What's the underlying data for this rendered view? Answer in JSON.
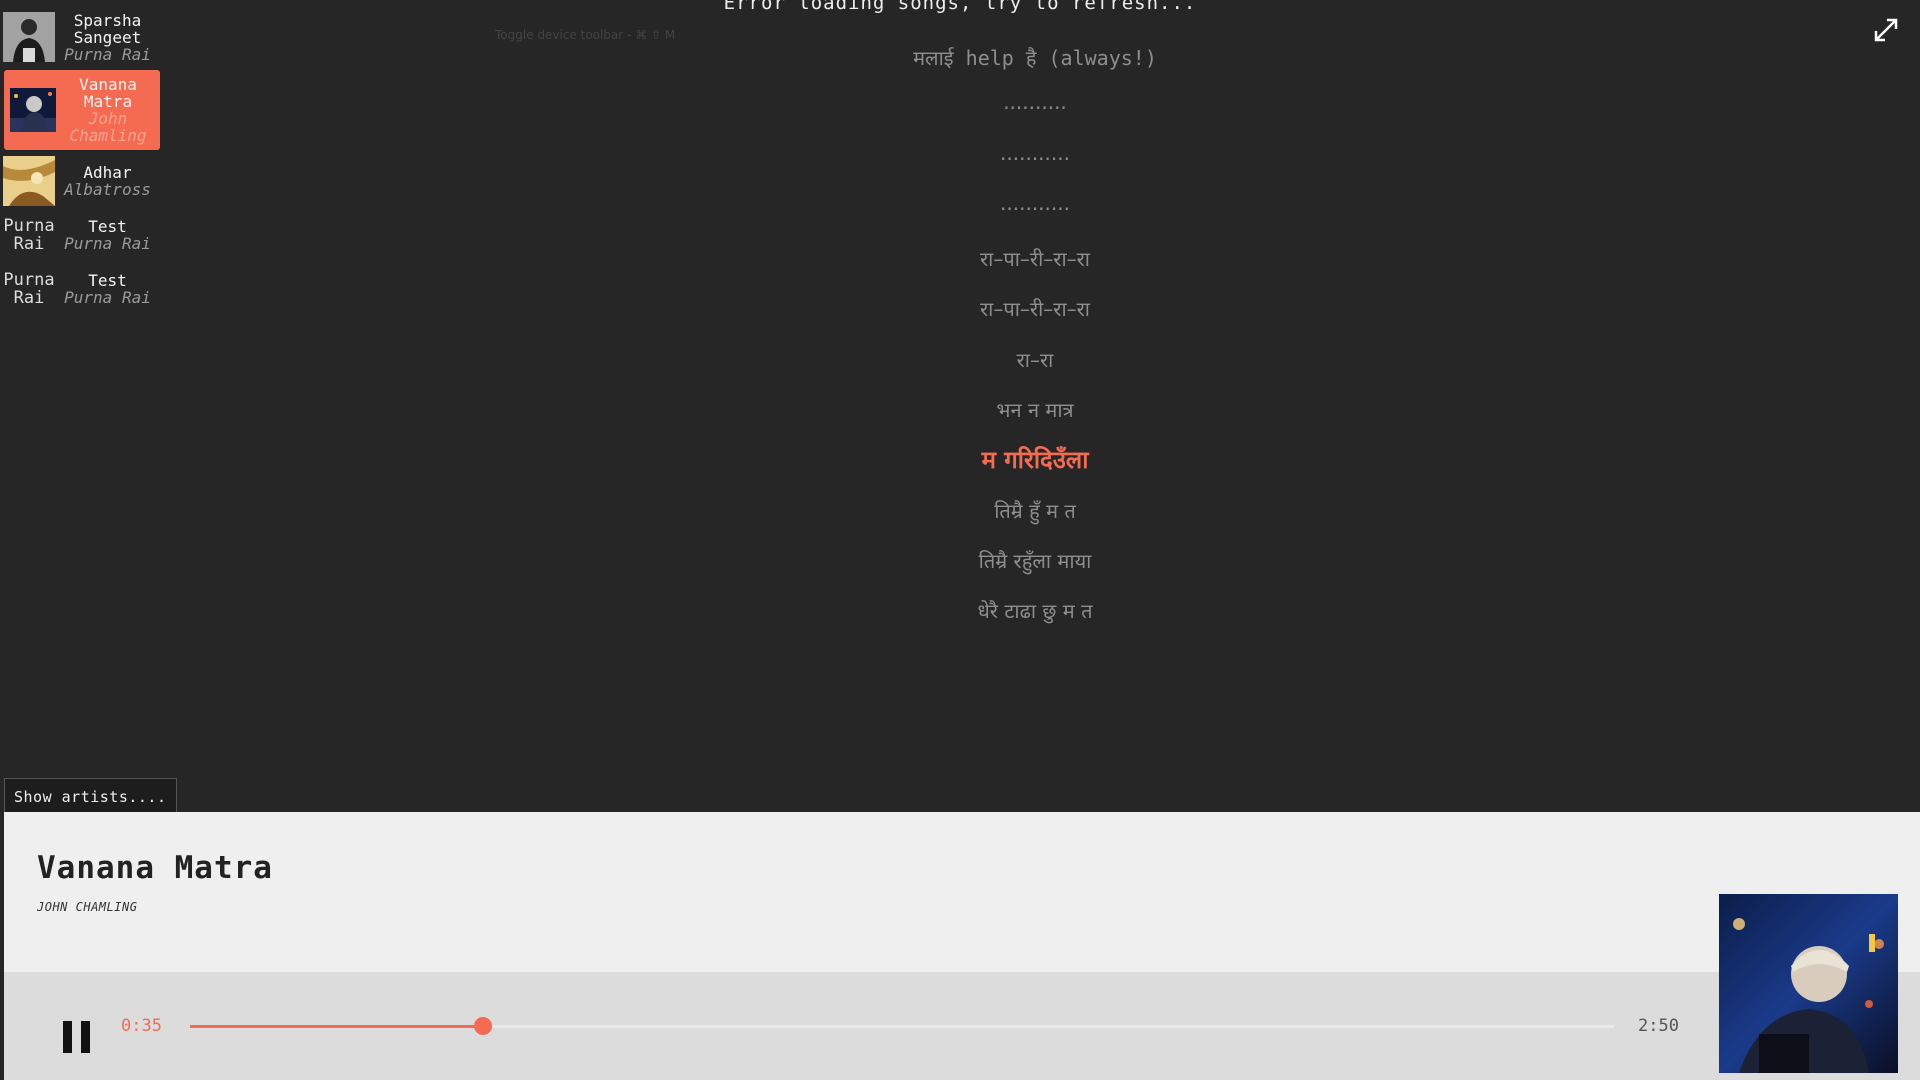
{
  "error_message": "Error loading songs, try to refresh...",
  "devtools_hint": "Toggle device toolbar - ⌘ ⇧ M",
  "accent_color": "#f46b52",
  "sidebar": {
    "songs": [
      {
        "title": "Sparsha Sangeet",
        "artist": "Purna Rai",
        "thumb": "photo",
        "active": false
      },
      {
        "title": "Vanana Matra",
        "artist": "John Chamling",
        "thumb": "photo",
        "active": true
      },
      {
        "title": "Adhar",
        "artist": "Albatross",
        "thumb": "photo",
        "active": false
      },
      {
        "title": "Test",
        "artist": "Purna Rai",
        "thumb_alt": "Purna Rai",
        "active": false
      },
      {
        "title": "Test",
        "artist": "Purna Rai",
        "thumb_alt": "Purna Rai",
        "active": false
      }
    ]
  },
  "lyrics": {
    "lines": [
      "मलाई help है (always!)",
      "··········",
      "···········",
      "···········",
      "रा–पा–री–रा–रा",
      "रा–पा–री–रा–रा",
      "रा–रा",
      "भन न मात्र",
      "म गरिदिउँला",
      "तिम्रै हुँ म त",
      "तिम्रै रहुँला माया",
      "धेरै टाढा छु म त"
    ],
    "current_index": 8
  },
  "show_artists_label": "Show artists....",
  "player": {
    "title": "Vanana Matra",
    "artist": "JOHN CHAMLING",
    "time_current": "0:35",
    "time_total": "2:50",
    "progress": 0.2059
  },
  "icons": {
    "expand": "expand-icon",
    "pause": "pause-icon"
  }
}
